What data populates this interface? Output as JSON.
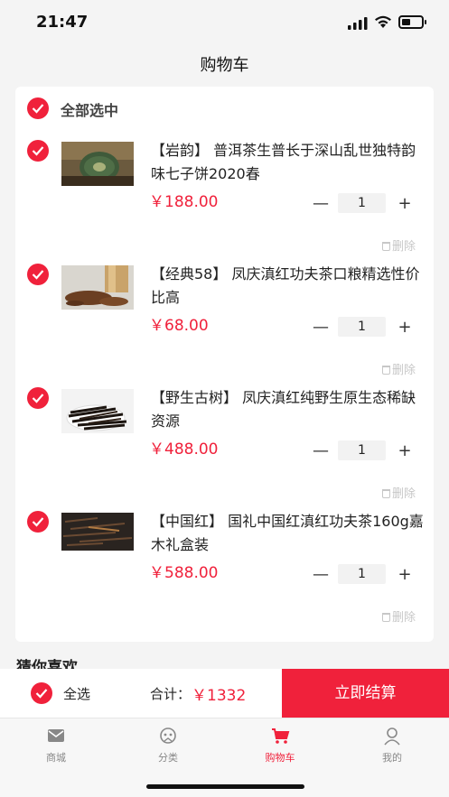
{
  "status_bar": {
    "time": "21:47"
  },
  "header": {
    "title": "购物车"
  },
  "cart": {
    "select_all_label": "全部选中",
    "delete_label": "删除",
    "items": [
      {
        "title": "【岩韵】 普洱茶生普长于深山乱世独特韵味七子饼2020春",
        "price": "￥188.00",
        "quantity": "1"
      },
      {
        "title": "【经典58】 凤庆滇红功夫茶口粮精选性价比高",
        "price": "￥68.00",
        "quantity": "1"
      },
      {
        "title": "【野生古树】 凤庆滇红纯野生原生态稀缺资源",
        "price": "￥488.00",
        "quantity": "1"
      },
      {
        "title": "【中国红】 国礼中国红滇红功夫茶160g嘉木礼盒装",
        "price": "￥588.00",
        "quantity": "1"
      }
    ]
  },
  "recommend": {
    "title": "猜你喜欢"
  },
  "checkout": {
    "select_all_label": "全选",
    "total_label": "合计：",
    "total_value": "￥1332",
    "button_label": "立即结算"
  },
  "tabs": [
    {
      "label": "商城",
      "icon": "mail-icon"
    },
    {
      "label": "分类",
      "icon": "category-icon"
    },
    {
      "label": "购物车",
      "icon": "cart-icon",
      "active": true
    },
    {
      "label": "我的",
      "icon": "user-icon"
    }
  ],
  "colors": {
    "accent": "#f0213b",
    "background": "#f4f4f4"
  }
}
